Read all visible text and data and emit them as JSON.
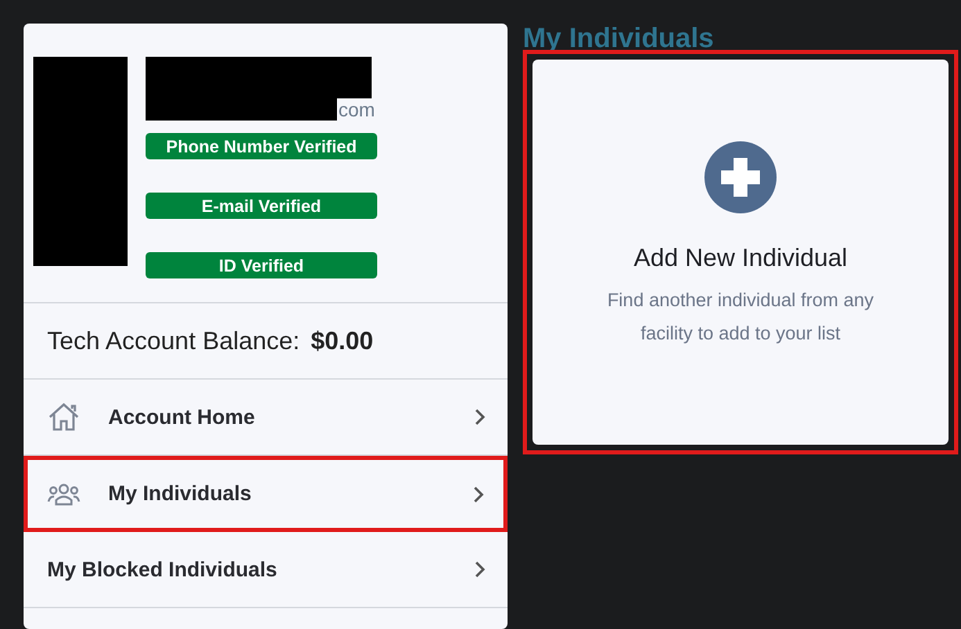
{
  "profile": {
    "email_suffix": "com",
    "badges": [
      {
        "label": "Phone Number Verified",
        "verified": true
      },
      {
        "label": "E-mail Verified",
        "verified": true
      },
      {
        "label": "ID Verified",
        "verified": true
      }
    ]
  },
  "balance": {
    "label": "Tech Account Balance:",
    "value": "$0.00"
  },
  "menu": [
    {
      "label": "Account Home",
      "kind": "home",
      "highlighted": false
    },
    {
      "label": "My Individuals",
      "kind": "group",
      "highlighted": true
    },
    {
      "label": "My Blocked Individuals",
      "kind": "plain",
      "highlighted": false
    }
  ],
  "heading": "My Individuals",
  "add_card": {
    "title": "Add New Individual",
    "description": "Find another individual from any facility to add to your list",
    "highlighted": true
  }
}
